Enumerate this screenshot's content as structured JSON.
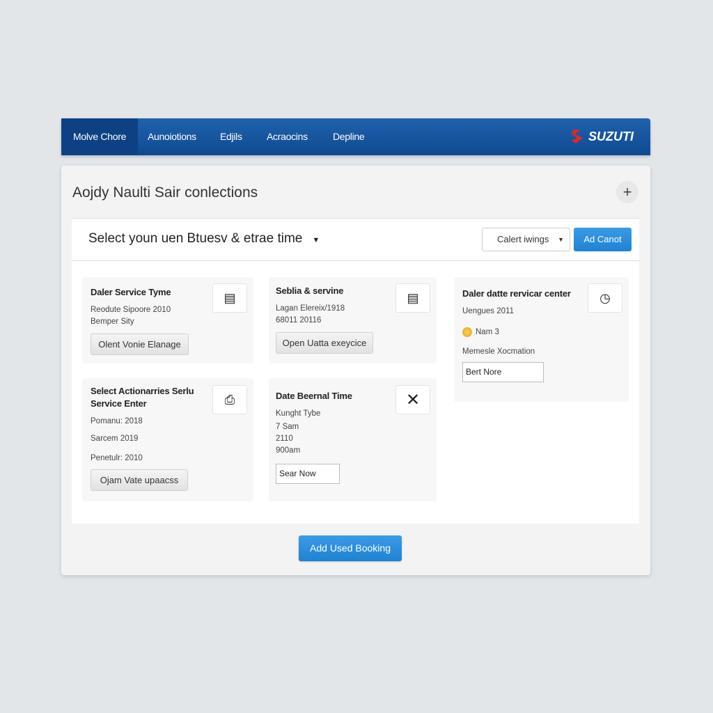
{
  "nav": {
    "tabs": [
      "Molve Chore",
      "Aunoiotions",
      "Edjils",
      "Acraocins",
      "Depline"
    ],
    "active": 0,
    "brand": "SUZUTI"
  },
  "panel": {
    "title": "Aojdy Naulti Sair conlections",
    "selector": "Select youn uen Btuesv & etrae time",
    "filter": "Calert iwings",
    "add_button": "Ad Canot"
  },
  "cards": [
    {
      "title": "Daler Service Tyme",
      "lines": [
        "Reodute Sipoore 2010",
        "Bemper Sity"
      ],
      "button": "Olent Vonie Elanage",
      "icon": "clipboard-icon"
    },
    {
      "title": "Seblia & servine",
      "lines": [
        "Lagan Elereix/1918",
        "68011 20116"
      ],
      "button": "Open Uatta exeycice",
      "icon": "clipboard-icon"
    },
    {
      "title": "Daler datte rervicar center",
      "lines": [
        "Uengues 2011",
        "Nam 3",
        "Memesle Xocmation"
      ],
      "input": "Bert Nore",
      "icon": "clock-icon"
    },
    {
      "title": "Select Actionarries Serlu Service Enter",
      "lines": [
        "Pomanu: 2018",
        "Sarcem 2019",
        "Penetulr: 2010"
      ],
      "button": "Ojam Vate upaacss",
      "icon": "printer-icon"
    },
    {
      "title": "Date Beernal Time",
      "lines": [
        "Kunght Tybe",
        "7 Sam",
        "2110",
        "900am"
      ],
      "input": "Sear Now",
      "icon": "close-icon"
    }
  ],
  "footer": {
    "book_button": "Add Used Booking"
  },
  "colors": {
    "nav": "#1a5aa5",
    "accent": "#2a8cdc",
    "brand_logo": "#e0262b"
  }
}
